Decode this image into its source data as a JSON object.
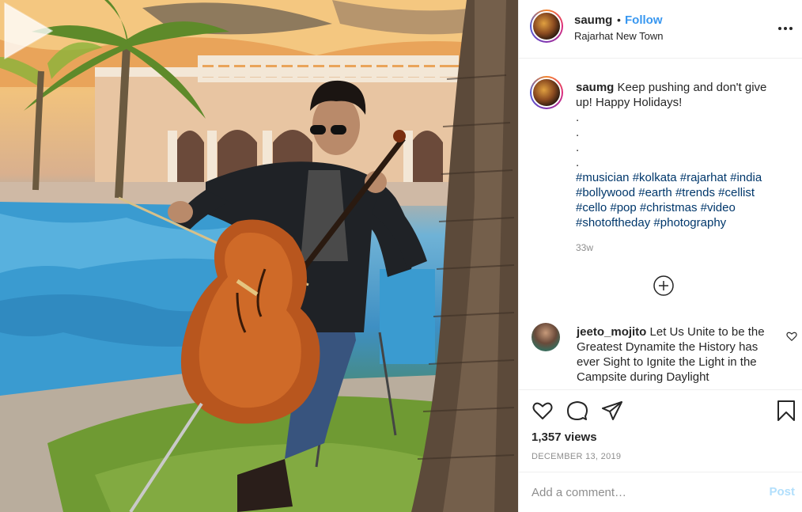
{
  "post": {
    "username": "saumg",
    "separator": "•",
    "follow_label": "Follow",
    "location": "Rajarhat New Town",
    "caption_text": "Keep pushing and don't give up! Happy Holidays!",
    "caption_dots": [
      ".",
      ".",
      ".",
      "."
    ],
    "hashtags": [
      "#musician",
      "#kolkata",
      "#rajarhat",
      "#india",
      "#bollywood",
      "#earth",
      "#trends",
      "#cellist",
      "#cello",
      "#pop",
      "#christmas",
      "#video",
      "#shotoftheday",
      "#photography"
    ],
    "age": "33w",
    "views": "1,357 views",
    "date": "DECEMBER 13, 2019"
  },
  "comments": [
    {
      "username": "jeeto_mojito",
      "text": "Let Us Unite to be the Greatest Dynamite the History has ever Sight to Ignite the Light in the Campsite during Daylight"
    }
  ],
  "composer": {
    "placeholder": "Add a comment…",
    "post_label": "Post"
  },
  "icons": {
    "more": "more-options-icon",
    "load_more": "plus-circle-icon",
    "like": "heart-icon",
    "comment": "comment-bubble-icon",
    "share": "paper-plane-icon",
    "save": "bookmark-icon",
    "play": "play-icon"
  },
  "colors": {
    "link_blue": "#3897f0",
    "hashtag": "#00376b",
    "muted": "#8e8e8e",
    "post_disabled": "#b2dffc"
  }
}
